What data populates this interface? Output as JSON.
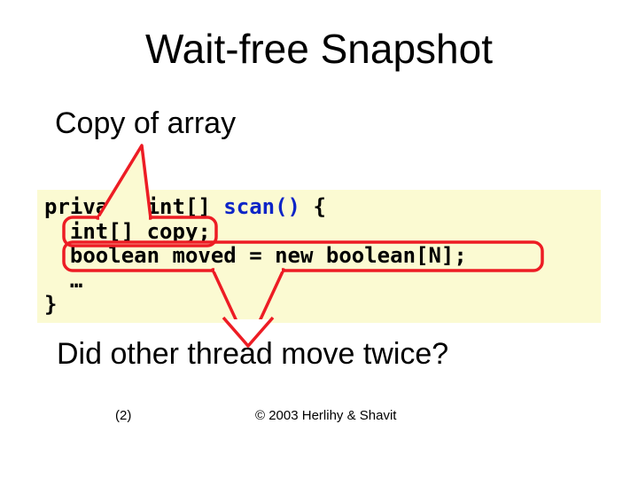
{
  "title": "Wait-free Snapshot",
  "annotation_top": "Copy of array",
  "annotation_bottom": "Did other thread move twice?",
  "code": {
    "l1a": "private int[] ",
    "l1b": "scan()",
    "l1c": " {",
    "l2": "  int[] copy;",
    "l3": "  boolean moved = new boolean[N];",
    "l4": "  …",
    "l5": "}"
  },
  "pagenum": "(2)",
  "copyright": "© 2003 Herlihy & Shavit"
}
